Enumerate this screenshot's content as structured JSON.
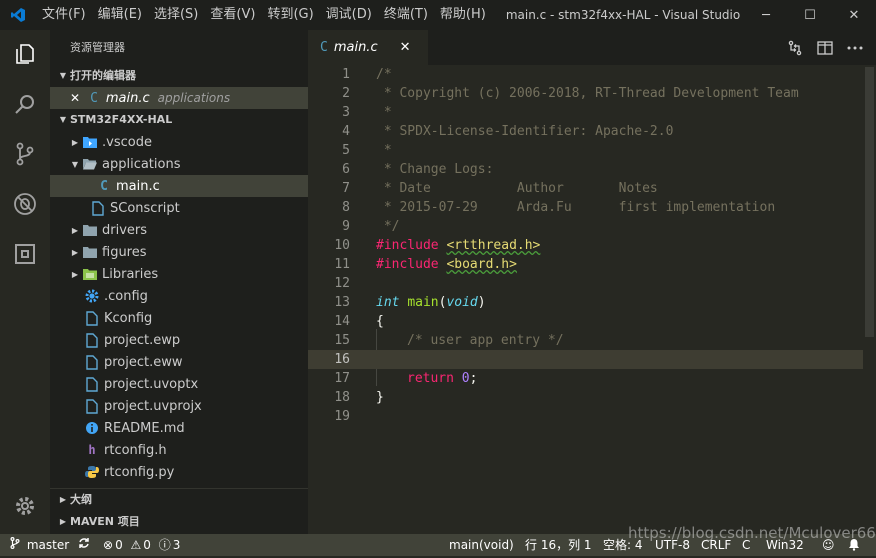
{
  "titlebar": {
    "menus": [
      "文件(F)",
      "编辑(E)",
      "选择(S)",
      "查看(V)",
      "转到(G)",
      "调试(D)",
      "终端(T)",
      "帮助(H)"
    ],
    "window_title": "main.c - stm32f4xx-HAL - Visual Studio C...",
    "minimize": "─",
    "maximize": "☐",
    "close": "✕"
  },
  "sidebar": {
    "title": "资源管理器",
    "open_editors_header": "打开的编辑器",
    "open_editor": {
      "close": "✕",
      "icon": "C",
      "name": "main.c",
      "folder": "applications"
    },
    "project_header": "STM32F4XX-HAL",
    "tree": [
      {
        "name": ".vscode",
        "kind": "folder-vscode",
        "expanded": false
      },
      {
        "name": "applications",
        "kind": "folder",
        "expanded": true
      },
      {
        "name": "main.c",
        "kind": "c-file"
      },
      {
        "name": "SConscript",
        "kind": "file"
      },
      {
        "name": "drivers",
        "kind": "folder",
        "expanded": false
      },
      {
        "name": "figures",
        "kind": "folder",
        "expanded": false
      },
      {
        "name": "Libraries",
        "kind": "folder-lib",
        "expanded": false
      },
      {
        "name": ".config",
        "kind": "gear-file"
      },
      {
        "name": "Kconfig",
        "kind": "file"
      },
      {
        "name": "project.ewp",
        "kind": "file"
      },
      {
        "name": "project.eww",
        "kind": "file"
      },
      {
        "name": "project.uvoptx",
        "kind": "file"
      },
      {
        "name": "project.uvprojx",
        "kind": "file"
      },
      {
        "name": "README.md",
        "kind": "info-file"
      },
      {
        "name": "rtconfig.h",
        "kind": "h-file"
      },
      {
        "name": "rtconfig.py",
        "kind": "py-file"
      }
    ],
    "outline_header": "大纲",
    "maven_header": "MAVEN 项目"
  },
  "tab": {
    "icon": "C",
    "label": "main.c",
    "close": "✕"
  },
  "editor": {
    "line_numbers": [
      "1",
      "2",
      "3",
      "4",
      "5",
      "6",
      "7",
      "8",
      "9",
      "10",
      "11",
      "12",
      "13",
      "14",
      "15",
      "16",
      "17",
      "18",
      "19"
    ],
    "l1": "/*",
    "l2": " * Copyright (c) 2006-2018, RT-Thread Development Team",
    "l3": " *",
    "l4": " * SPDX-License-Identifier: Apache-2.0",
    "l5": " *",
    "l6": " * Change Logs:",
    "l7": " * Date           Author       Notes",
    "l8": " * 2015-07-29     Arda.Fu      first implementation",
    "l9": " */",
    "l10_kw": "#include",
    "l10_str": "<rtthread.h>",
    "l11_kw": "#include",
    "l11_str": "<board.h>",
    "l13_type": "int",
    "l13_fn": "main",
    "l13_open": "(",
    "l13_void": "void",
    "l13_close": ")",
    "l14": "{",
    "l15": "/* user app entry */",
    "l17_kw": "return",
    "l17_num": "0",
    "l17_semi": ";",
    "l18": "}"
  },
  "statusbar": {
    "branch": "master",
    "errors": "0",
    "warnings": "0",
    "infos": "3",
    "function": "main(void)",
    "position": "行 16，列 1",
    "spaces": "空格: 4",
    "encoding": "UTF-8",
    "eol": "CRLF",
    "language": "C",
    "platform": "Win32"
  },
  "watermark": "https://blog.csdn.net/Mculover666",
  "colors": {
    "accent": "#519aba",
    "status_bg": "#414339",
    "editor_bg": "#272822"
  }
}
